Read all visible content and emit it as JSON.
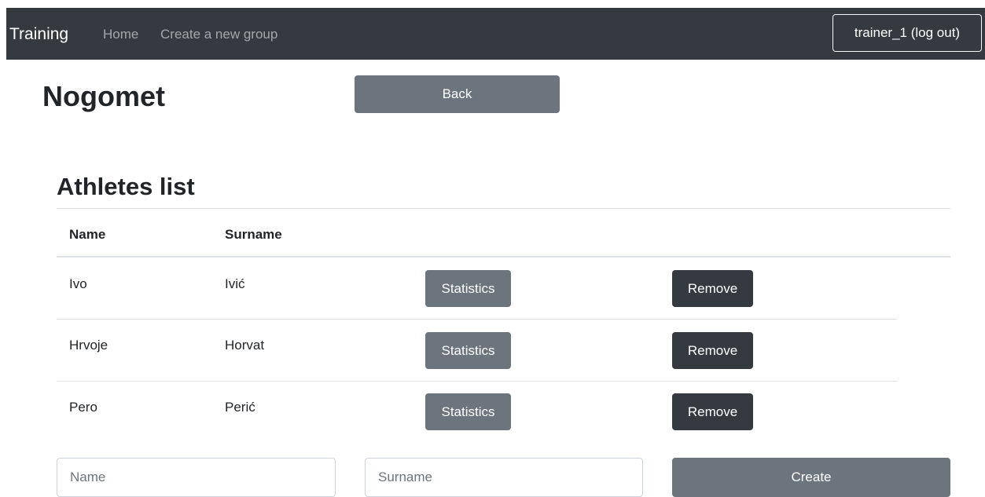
{
  "navbar": {
    "brand": "Training",
    "links": [
      "Home",
      "Create a new group"
    ],
    "user_button": "trainer_1 (log out)"
  },
  "group": {
    "title": "Nogomet",
    "back_label": "Back"
  },
  "athletes": {
    "heading": "Athletes list",
    "columns": [
      "Name",
      "Surname"
    ],
    "rows": [
      {
        "name": "Ivo",
        "surname": "Ivić",
        "statistics": "Statistics",
        "remove": "Remove"
      },
      {
        "name": "Hrvoje",
        "surname": "Horvat",
        "statistics": "Statistics",
        "remove": "Remove"
      },
      {
        "name": "Pero",
        "surname": "Perić",
        "statistics": "Statistics",
        "remove": "Remove"
      }
    ]
  },
  "form": {
    "name_value": "",
    "name_placeholder": "Name",
    "surname_value": "",
    "surname_placeholder": "Surname",
    "create_label": "Create"
  },
  "colors": {
    "navbar_bg": "#343a40",
    "secondary": "#6c757d",
    "dark": "#343a40"
  }
}
